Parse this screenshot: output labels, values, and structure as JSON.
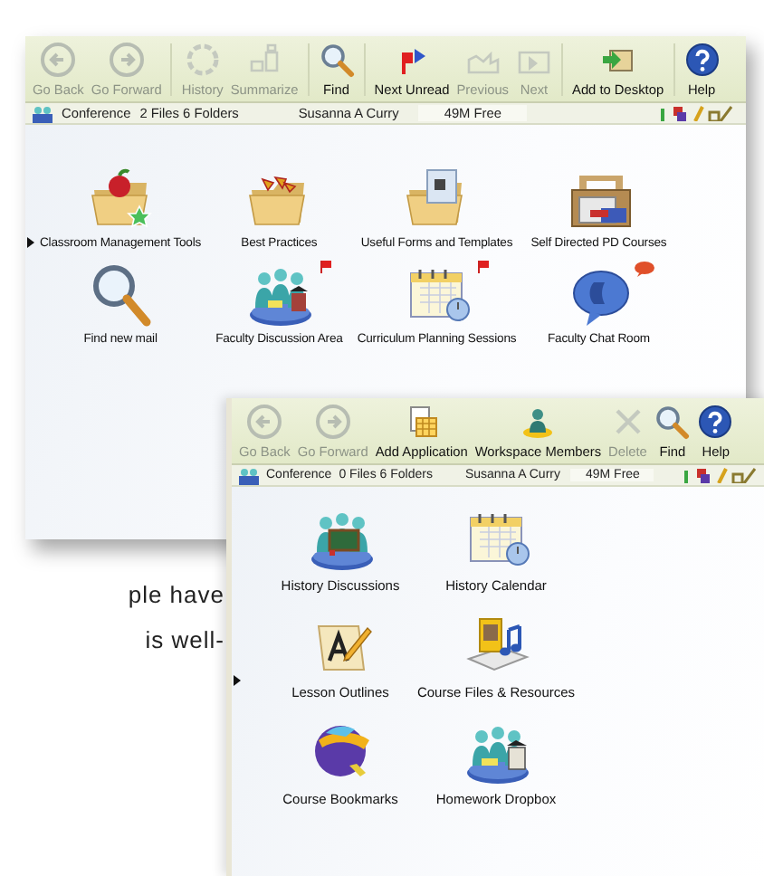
{
  "windows": [
    {
      "toolbar": [
        {
          "label": "Go Back",
          "disabled": true,
          "separator_after": false
        },
        {
          "label": "Go Forward",
          "disabled": true,
          "separator_after": true
        },
        {
          "label": "History",
          "disabled": true,
          "separator_after": false
        },
        {
          "label": "Summarize",
          "disabled": true,
          "separator_after": true
        },
        {
          "label": "Find",
          "disabled": false,
          "separator_after": true
        },
        {
          "label": "Next Unread",
          "disabled": false,
          "separator_after": false
        },
        {
          "label": "Previous",
          "disabled": true,
          "separator_after": false
        },
        {
          "label": "Next",
          "disabled": true,
          "separator_after": true
        },
        {
          "label": "Add to Desktop",
          "disabled": false,
          "separator_after": true
        },
        {
          "label": "Help",
          "disabled": false,
          "separator_after": false
        }
      ],
      "status": {
        "type": "Conference",
        "counts": "2 Files 6 Folders",
        "user": "Susanna A Curry",
        "free": "49M Free"
      },
      "items": [
        {
          "label": "Classroom Management Tools",
          "flagged": false,
          "chat_invite": false
        },
        {
          "label": "Best Practices",
          "flagged": false,
          "chat_invite": false
        },
        {
          "label": "Useful Forms and Templates",
          "flagged": false,
          "chat_invite": false
        },
        {
          "label": "Self Directed PD Courses",
          "flagged": false,
          "chat_invite": false
        },
        {
          "label": "Find new mail",
          "flagged": false,
          "chat_invite": false
        },
        {
          "label": "Faculty Discussion Area",
          "flagged": true,
          "chat_invite": false
        },
        {
          "label": "Curriculum Planning Sessions",
          "flagged": true,
          "chat_invite": false
        },
        {
          "label": "Faculty Chat Room",
          "flagged": false,
          "chat_invite": true
        }
      ]
    },
    {
      "toolbar": [
        {
          "label": "Go Back",
          "disabled": true,
          "separator_after": false
        },
        {
          "label": "Go Forward",
          "disabled": true,
          "separator_after": false
        },
        {
          "label": "Add Application",
          "disabled": false,
          "separator_after": false
        },
        {
          "label": "Workspace Members",
          "disabled": false,
          "separator_after": false
        },
        {
          "label": "Delete",
          "disabled": true,
          "separator_after": false
        },
        {
          "label": "Find",
          "disabled": false,
          "separator_after": false
        },
        {
          "label": "Help",
          "disabled": false,
          "separator_after": false
        }
      ],
      "status": {
        "type": "Conference",
        "counts": "0 Files 6 Folders",
        "user": "Susanna A Curry",
        "free": "49M Free"
      },
      "items": [
        {
          "label": "History Discussions",
          "flagged": false,
          "chat_invite": false
        },
        {
          "label": "History Calendar",
          "flagged": false,
          "chat_invite": false
        },
        {
          "label": "Lesson Outlines",
          "flagged": false,
          "chat_invite": false
        },
        {
          "label": "Course Files & Resources",
          "flagged": false,
          "chat_invite": false
        },
        {
          "label": "Course Bookmarks",
          "flagged": false,
          "chat_invite": false
        },
        {
          "label": "Homework Dropbox",
          "flagged": false,
          "chat_invite": false
        }
      ]
    }
  ],
  "document_text": [
    "ple have",
    "is well-"
  ]
}
